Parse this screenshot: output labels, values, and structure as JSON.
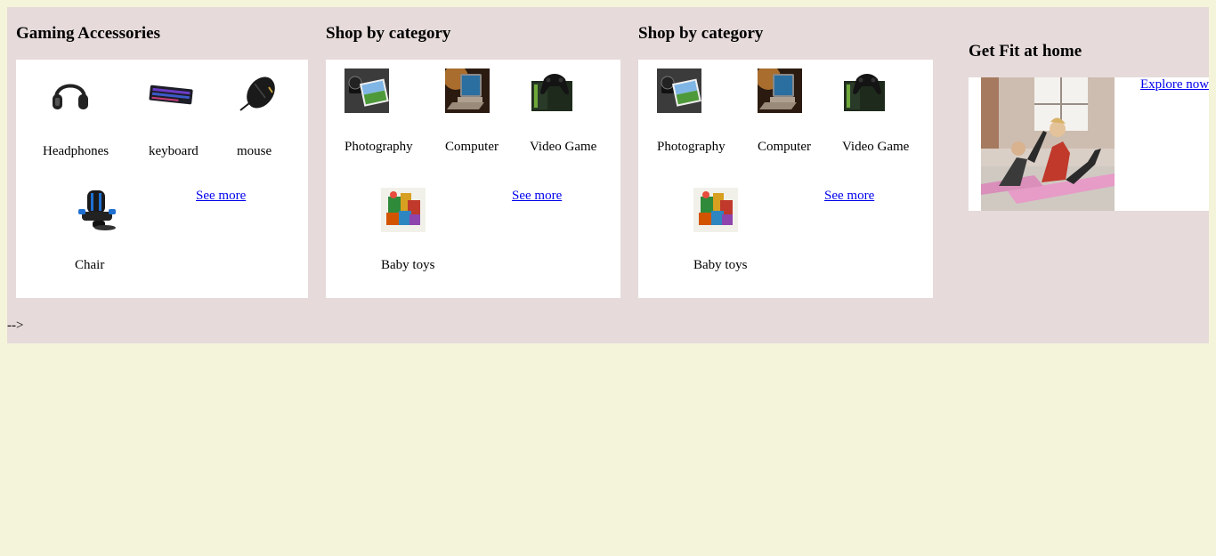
{
  "cards": [
    {
      "heading": "Gaming Accessories",
      "items": [
        {
          "label": "Headphones",
          "icon": "headphones-icon"
        },
        {
          "label": "keyboard",
          "icon": "keyboard-icon"
        },
        {
          "label": "mouse",
          "icon": "mouse-icon"
        },
        {
          "label": "Chair",
          "icon": "gaming-chair-icon"
        }
      ],
      "see_more": "See more"
    },
    {
      "heading": "Shop by category",
      "items": [
        {
          "label": "Photography",
          "icon": "camera-photo-icon"
        },
        {
          "label": "Computer",
          "icon": "laptop-icon"
        },
        {
          "label": "Video Game",
          "icon": "game-controller-icon"
        },
        {
          "label": "Baby toys",
          "icon": "baby-toys-icon"
        }
      ],
      "see_more": "See more"
    },
    {
      "heading": "Shop by category",
      "items": [
        {
          "label": "Photography",
          "icon": "camera-photo-icon"
        },
        {
          "label": "Computer",
          "icon": "laptop-icon"
        },
        {
          "label": "Video Game",
          "icon": "game-controller-icon"
        },
        {
          "label": "Baby toys",
          "icon": "baby-toys-icon"
        }
      ],
      "see_more": "See more"
    }
  ],
  "fitness": {
    "heading": "Get Fit at home",
    "explore": "Explore now",
    "image": "fitness-workout-photo"
  },
  "stray_text": "-->",
  "colors": {
    "page_bg": "#f4f4da",
    "band_bg": "#e6dada",
    "card_bg": "#ffffff",
    "link": "#0000ee"
  }
}
